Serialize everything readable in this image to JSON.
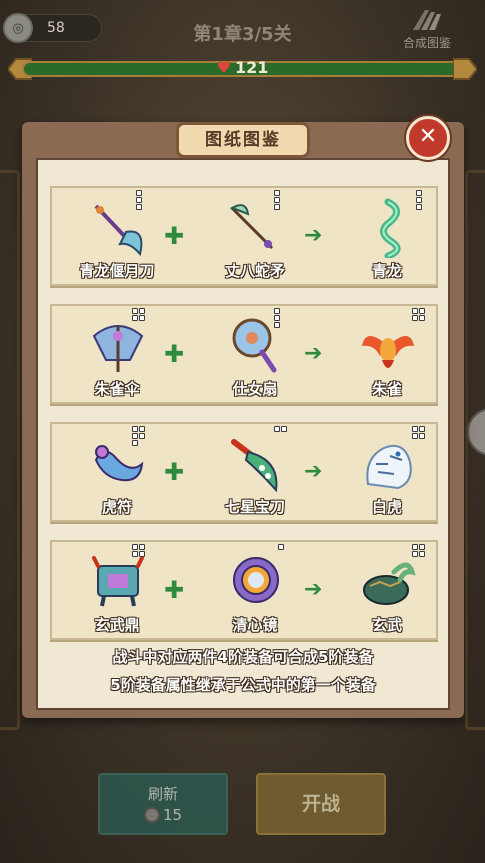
{
  "topbar": {
    "coins": "58",
    "level_title": "第1章3/5关",
    "codex_label": "合成图鉴",
    "hp": "121"
  },
  "dialog": {
    "title": "图纸图鉴",
    "close_icon": "close-x",
    "recipes": [
      {
        "a": {
          "name": "青龙偃月刀",
          "tier": 3,
          "icon": "glaive"
        },
        "b": {
          "name": "丈八蛇矛",
          "tier": 3,
          "icon": "serpent-spear"
        },
        "result": {
          "name": "青龙",
          "tier": 3,
          "icon": "azure-dragon"
        }
      },
      {
        "a": {
          "name": "朱雀伞",
          "tier": 4,
          "icon": "umbrella"
        },
        "b": {
          "name": "仕女扇",
          "tier": 3,
          "icon": "round-fan"
        },
        "result": {
          "name": "朱雀",
          "tier": 4,
          "icon": "vermilion-bird"
        }
      },
      {
        "a": {
          "name": "虎符",
          "tier": 5,
          "icon": "tiger-tally"
        },
        "b": {
          "name": "七星宝刀",
          "tier": 2,
          "icon": "seven-star-sabre"
        },
        "result": {
          "name": "白虎",
          "tier": 4,
          "icon": "white-tiger"
        }
      },
      {
        "a": {
          "name": "玄武鼎",
          "tier": 4,
          "icon": "cauldron"
        },
        "b": {
          "name": "清心镜",
          "tier": 1,
          "icon": "mirror"
        },
        "result": {
          "name": "玄武",
          "tier": 4,
          "icon": "black-tortoise"
        }
      }
    ],
    "note_line1": "战斗中对应两件4阶装备可合成5阶装备",
    "note_line2": "5阶装备属性继承于公式中的第一个装备"
  },
  "buttons": {
    "refresh_label": "刷新",
    "refresh_cost": "15",
    "start_label": "开战"
  },
  "colors": {
    "dialog_frame": "#8a6a52",
    "parchment": "#f1e8d3",
    "plus_arrow": "#2e8b3e",
    "close_red": "#c0392b",
    "hp_green": "#2c6a2a"
  }
}
